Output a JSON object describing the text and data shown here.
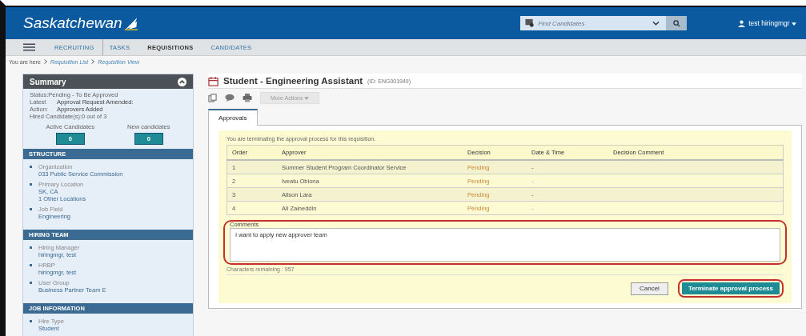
{
  "header": {
    "logo": "Saskatchewan",
    "search": {
      "placeholder": "Find Candidates"
    },
    "user": "test hiringmgr"
  },
  "nav": {
    "items": [
      {
        "label": "RECRUITING",
        "selected": false
      },
      {
        "label": "TASKS",
        "selected": false
      },
      {
        "label": "REQUISITIONS",
        "selected": true
      },
      {
        "label": "CANDIDATES",
        "selected": false
      }
    ]
  },
  "breadcrumb": {
    "prefix": "You are here",
    "links": [
      "Requisition List",
      "Requisition View"
    ]
  },
  "summary": {
    "title": "Summary",
    "status": "Status:Pending - To Be Approved",
    "latest_label": "Latest",
    "latest_value": "Approval Request Amended:",
    "action_label": "Action:",
    "action_value": "Approvers Added",
    "hired": "Hired Candidate(s):0 out of 3",
    "counters": [
      {
        "label": "Active Candidates",
        "value": "0"
      },
      {
        "label": "New candidates",
        "value": "0"
      }
    ]
  },
  "sections": [
    {
      "title": "STRUCTURE",
      "items": [
        {
          "label": "Organization",
          "values": [
            "033 Public Service Commission"
          ]
        },
        {
          "label": "Primary Location",
          "values": [
            "SK, CA",
            "1 Other Locations"
          ]
        },
        {
          "label": "Job Field",
          "values": [
            "Engineering"
          ]
        }
      ]
    },
    {
      "title": "HIRING TEAM",
      "items": [
        {
          "label": "Hiring Manager",
          "values": [
            "hiringmgr, test"
          ]
        },
        {
          "label": "HRBP",
          "values": [
            "hiringmgr, test"
          ]
        },
        {
          "label": "User Group",
          "values": [
            "Business Partner Team E"
          ]
        }
      ]
    },
    {
      "title": "JOB INFORMATION",
      "items": [
        {
          "label": "Hire Type",
          "values": [
            "Student"
          ]
        }
      ]
    }
  ],
  "requisition": {
    "title": "Student - Engineering Assistant",
    "id": "(ID: ENG001949)",
    "more_actions": "More Actions",
    "tabs": [
      {
        "label": "Approvals",
        "selected": true
      }
    ]
  },
  "approvals": {
    "notice": "You are terminating the approval process for this requisition.",
    "columns": [
      "Order",
      "Approver",
      "Decision",
      "Date & Time",
      "Decision Comment"
    ],
    "rows": [
      {
        "order": "1",
        "approver": "Summer Student Program Coordinator Service",
        "decision": "Pending",
        "date": "-"
      },
      {
        "order": "2",
        "approver": "Iveatu Obiona",
        "decision": "Pending",
        "date": "-"
      },
      {
        "order": "3",
        "approver": "Alison Lara",
        "decision": "Pending",
        "date": "-"
      },
      {
        "order": "4",
        "approver": "Ali Zaineddin",
        "decision": "Pending",
        "date": "-"
      }
    ],
    "comments_label": "Comments",
    "comments_value": "I want to apply new approver team",
    "chars_remaining": "Characters remaining : 957",
    "buttons": [
      {
        "label": "Cancel",
        "kind": "secondary"
      },
      {
        "label": "Terminate approval process",
        "kind": "primary"
      }
    ]
  }
}
